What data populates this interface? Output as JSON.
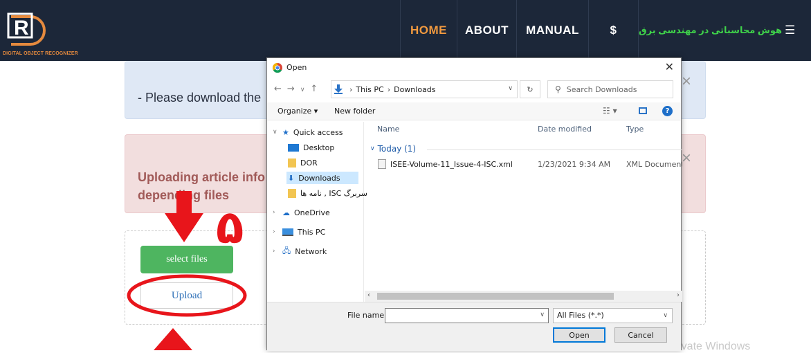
{
  "navbar": {
    "brand_text": "DIGITAL OBJECT RECOGNIZER",
    "items": [
      "HOME",
      "ABOUT",
      "MANUAL",
      "$"
    ],
    "persian_title": "هوش محاسباتی در مهندسی برق",
    "menu_icon": "hamburger-icon",
    "accent_color": "#f29a3f",
    "persian_color": "#3fd24a"
  },
  "page": {
    "info_text": "- Please download the",
    "danger_text_1": "Uploading article info",
    "danger_text_2": "depending files",
    "close_glyph": "×",
    "select_button": "select files",
    "upload_button": "Upload",
    "annotation_number": "۵",
    "watermark": "Activate Windows"
  },
  "dialog": {
    "title": "Open",
    "close_glyph": "✕",
    "breadcrumb": [
      "This PC",
      "Downloads"
    ],
    "search_placeholder": "Search Downloads",
    "organize_label": "Organize ▾",
    "new_folder_label": "New folder",
    "nav_pane": [
      {
        "label": "Quick access",
        "icon": "star-icon"
      },
      {
        "label": "Desktop",
        "icon": "desktop-icon"
      },
      {
        "label": "DOR",
        "icon": "folder-icon"
      },
      {
        "label": "Downloads",
        "icon": "download-icon"
      },
      {
        "label": "نامه ها , ISC سربرگ",
        "icon": "folder-icon"
      },
      {
        "label": "OneDrive",
        "icon": "cloud-icon"
      },
      {
        "label": "This PC",
        "icon": "pc-icon"
      },
      {
        "label": "Network",
        "icon": "network-icon"
      }
    ],
    "columns": [
      "Name",
      "Date modified",
      "Type"
    ],
    "group_label": "Today (1)",
    "files": [
      {
        "name": "ISEE-Volume-11_Issue-4-ISC.xml",
        "date": "1/23/2021 9:34 AM",
        "type": "XML Document"
      }
    ],
    "file_name_label": "File name:",
    "file_name_value": "",
    "filter_value": "All Files (*.*)",
    "open_button": "Open",
    "cancel_button": "Cancel"
  }
}
